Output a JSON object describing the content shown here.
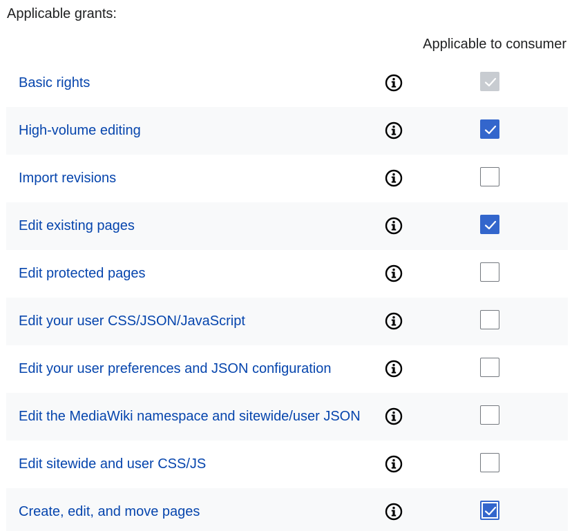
{
  "section_label": "Applicable grants:",
  "column_header": "Applicable to consumer",
  "colors": {
    "link": "#0645ad",
    "accent": "#3366cc",
    "row_alt": "#f8f9fa",
    "disabled": "#c8ccd1"
  },
  "info_icon": "info-circle-icon",
  "grants": [
    {
      "label": "Basic rights",
      "checked": true,
      "disabled": true,
      "focused": false
    },
    {
      "label": "High-volume editing",
      "checked": true,
      "disabled": false,
      "focused": false
    },
    {
      "label": "Import revisions",
      "checked": false,
      "disabled": false,
      "focused": false
    },
    {
      "label": "Edit existing pages",
      "checked": true,
      "disabled": false,
      "focused": false
    },
    {
      "label": "Edit protected pages",
      "checked": false,
      "disabled": false,
      "focused": false
    },
    {
      "label": "Edit your user CSS/JSON/JavaScript",
      "checked": false,
      "disabled": false,
      "focused": false
    },
    {
      "label": "Edit your user preferences and JSON configuration",
      "checked": false,
      "disabled": false,
      "focused": false
    },
    {
      "label": "Edit the MediaWiki namespace and sitewide/user JSON",
      "checked": false,
      "disabled": false,
      "focused": false
    },
    {
      "label": "Edit sitewide and user CSS/JS",
      "checked": false,
      "disabled": false,
      "focused": false
    },
    {
      "label": "Create, edit, and move pages",
      "checked": true,
      "disabled": false,
      "focused": true
    }
  ]
}
